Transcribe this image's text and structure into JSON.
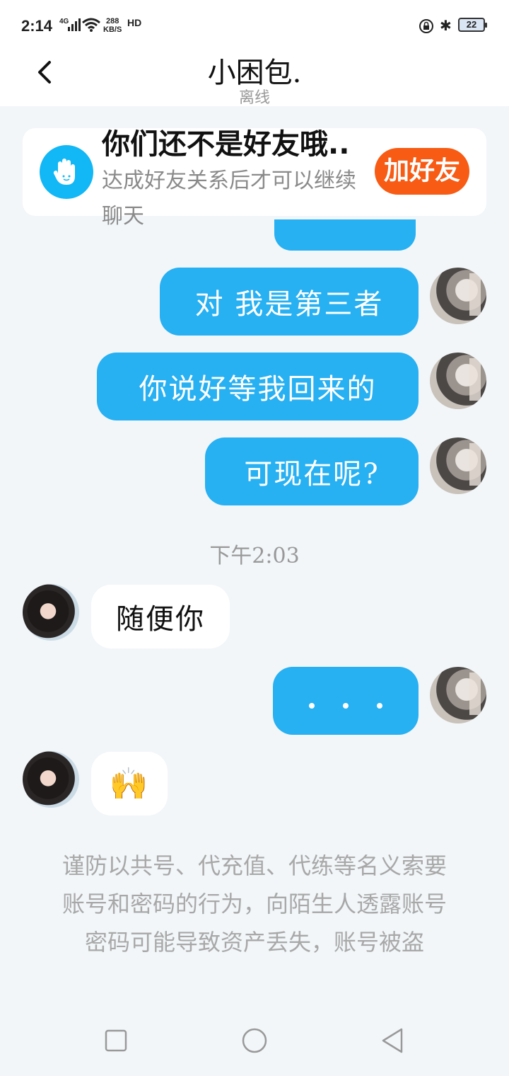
{
  "status_bar": {
    "time": "2:14",
    "network": "4G",
    "speed_value": "288",
    "speed_unit": "KB/S",
    "hd": "HD",
    "battery": "22"
  },
  "header": {
    "title": "小困包.",
    "status": "离线"
  },
  "friend_banner": {
    "title": "你们还不是好友哦..",
    "subtitle": "达成好友关系后才可以继续聊天",
    "button_label": "加好友"
  },
  "messages": [
    {
      "side": "out",
      "text": "对 我是第三者"
    },
    {
      "side": "out",
      "text": "你说好等我回来的"
    },
    {
      "side": "out",
      "text": "可现在呢?"
    },
    {
      "side": "in",
      "text": "随便你"
    },
    {
      "side": "out",
      "text": "。。。"
    },
    {
      "side": "in",
      "text": "🙌"
    }
  ],
  "time_separator": "下午2:03",
  "warning": "谨防以共号、代充值、代练等名义索要账号和密码的行为，向陌生人透露账号密码可能导致资产丢失，账号被盗",
  "colors": {
    "bubble_out": "#27b0f2",
    "add_button": "#f75b14",
    "background": "#f2f6f9"
  }
}
